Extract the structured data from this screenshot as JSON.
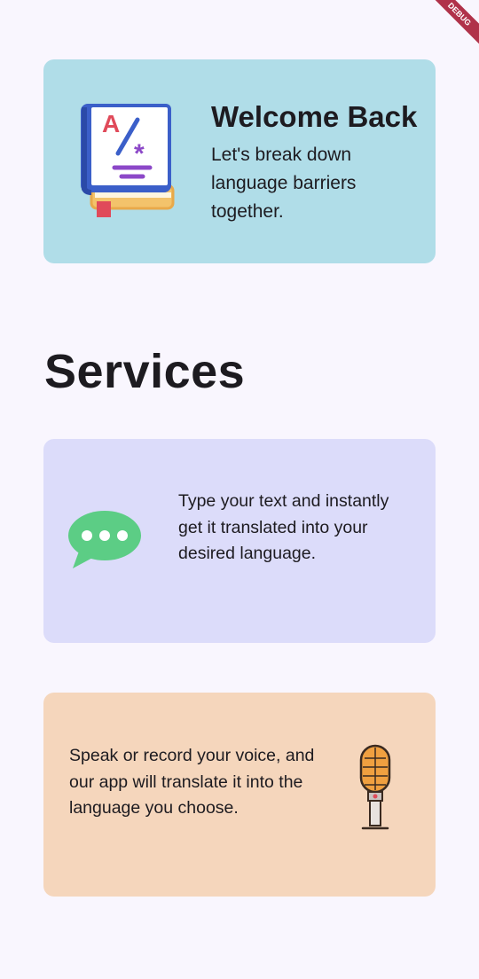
{
  "debug_banner": {
    "label": "DEBUG"
  },
  "welcome": {
    "title": "Welcome Back",
    "subtitle": "Let's break down language barriers together."
  },
  "services": {
    "heading": "Services",
    "items": [
      {
        "icon": "chat-bubble-icon",
        "description": "Type your text and instantly get it translated into your desired language."
      },
      {
        "icon": "microphone-icon",
        "description": "Speak or record your voice, and our app will translate it into the language you choose."
      }
    ]
  },
  "colors": {
    "background": "#f9f6fe",
    "welcome_card": "#b0dde8",
    "text_card": "#dcdcfa",
    "voice_card": "#f5d6bc",
    "chat_icon": "#5ccd85"
  }
}
